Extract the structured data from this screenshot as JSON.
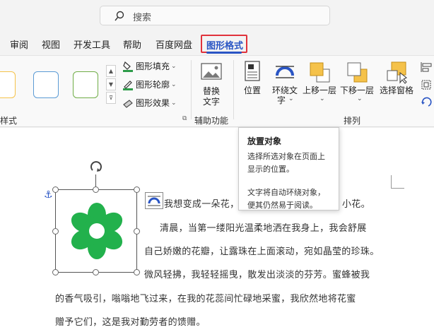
{
  "search": {
    "placeholder": "搜索"
  },
  "menu": {
    "tabs": [
      "审阅",
      "视图",
      "开发工具",
      "帮助",
      "百度网盘"
    ],
    "active_tab": "图形格式"
  },
  "ribbon": {
    "style_group_label": "样式",
    "shape_fill": "图形填充",
    "shape_outline": "图形轮廓",
    "shape_effects": "图形效果",
    "alt_text": [
      "替换",
      "文字"
    ],
    "accessibility_label": "辅助功能",
    "position": "位置",
    "wrap_text": [
      "环绕文",
      "字"
    ],
    "bring_forward": "上移一层",
    "send_backward": "下移一层",
    "selection_pane": "选择窗格",
    "arrange_label": "排列"
  },
  "tooltip": {
    "title": "放置对象",
    "lines": [
      "选择所选对象在页面上",
      "显示的位置。",
      "",
      "文字将自动环绕对象，",
      "便其仍然易于阅读。"
    ]
  },
  "document": {
    "line1_start": "我想变成一朵花，",
    "line1_end": "小花。",
    "lines": [
      "清晨，当第一缕阳光温柔地洒在我身上，我会舒展",
      "自己娇嫩的花瓣，让露珠在上面滚动，宛如晶莹的珍珠。",
      "微风轻拂，我轻轻摇曳，散发出淡淡的芬芳。蜜蜂被我",
      "的香气吸引，嗡嗡地飞过来，在我的花蕊间忙碌地采蜜，我欣然地将花蜜",
      "赠予它们，这是我对勤劳者的馈赠。"
    ]
  },
  "colors": {
    "accent": "#2a55c4",
    "highlight": "#e0323b",
    "flower": "#22b14c",
    "swatch_gold": "#f5c24a",
    "swatch_teal": "#5b9bd5",
    "swatch_green": "#70ad47"
  }
}
